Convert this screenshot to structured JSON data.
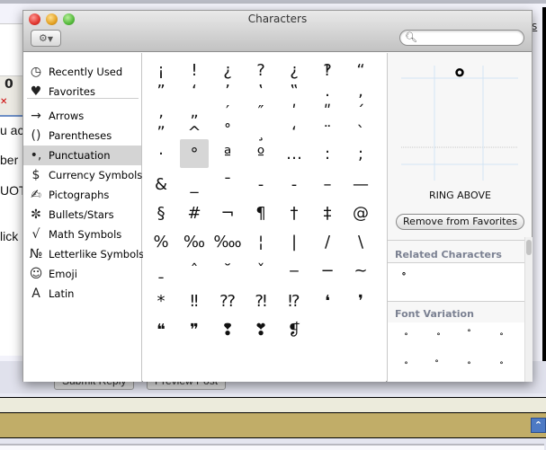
{
  "background_page": {
    "partial_texts": [
      "u ac",
      "ber",
      "UOT",
      "lick"
    ],
    "right_link_fragment": "s",
    "buttons": [
      "Submit Reply",
      "Preview Post"
    ],
    "icons": [
      "paperclip-icon",
      "strikethrough-icon",
      "scroll-to-top-icon"
    ]
  },
  "window": {
    "title": "Characters",
    "action_button_icon": "gear-icon",
    "search": {
      "placeholder": "",
      "value": ""
    }
  },
  "sidebar": {
    "items": [
      {
        "icon": "clock-icon",
        "glyph": "◷",
        "label": "Recently Used"
      },
      {
        "icon": "heart-icon",
        "glyph": "♥",
        "label": "Favorites"
      },
      {
        "icon": "arrow-icon",
        "glyph": "→",
        "label": "Arrows"
      },
      {
        "icon": "parentheses-icon",
        "glyph": "()",
        "label": "Parentheses"
      },
      {
        "icon": "punctuation-icon",
        "glyph": "•,",
        "label": "Punctuation",
        "selected": true
      },
      {
        "icon": "dollar-icon",
        "glyph": "$",
        "label": "Currency Symbols"
      },
      {
        "icon": "pencil-icon",
        "glyph": "✍",
        "label": "Pictographs"
      },
      {
        "icon": "asterisk-icon",
        "glyph": "✼",
        "label": "Bullets/Stars"
      },
      {
        "icon": "square-root-icon",
        "glyph": "√",
        "label": "Math Symbols"
      },
      {
        "icon": "numero-icon",
        "glyph": "№",
        "label": "Letterlike Symbols"
      },
      {
        "icon": "smiley-icon",
        "glyph": "☺",
        "label": "Emoji"
      },
      {
        "icon": "latin-a-icon",
        "glyph": "A",
        "label": "Latin"
      }
    ]
  },
  "grid": {
    "rows": [
      [
        "¡",
        "!",
        "¿",
        "?",
        "¿",
        "‽",
        "“"
      ],
      [
        "”",
        "‘",
        "’",
        "‛",
        "‟",
        ".",
        ","
      ],
      [
        "‚",
        "„",
        "′",
        "″",
        "ʹ",
        "ʺ",
        "ˊ"
      ],
      [
        "ˮ",
        "^",
        "˚",
        "¸",
        "ʻ",
        "¨",
        "ˋ"
      ],
      [
        "·",
        "°",
        "ª",
        "º",
        "…",
        ":",
        ";"
      ],
      [
        "&",
        "_",
        "¯",
        "‐",
        "-",
        "–",
        "—"
      ],
      [
        "§",
        "#",
        "¬",
        "¶",
        "†",
        "‡",
        "@"
      ],
      [
        "%",
        "‰",
        "‱",
        "¦",
        "|",
        "/",
        "\\"
      ],
      [
        "ˍ",
        "ˆ",
        "˘",
        "ˇ",
        "‒",
        "−",
        "~"
      ],
      [
        "*",
        "‼",
        "⁇",
        "⁈",
        "⁉",
        "❛",
        "❜"
      ],
      [
        "❝",
        "❞",
        "❢",
        "❣",
        "❡",
        "",
        ""
      ]
    ],
    "selected": {
      "row": 4,
      "col": 1
    }
  },
  "info": {
    "glyph": "˚",
    "name": "RING ABOVE",
    "favorite_button": "Remove from Favorites",
    "related_title": "Related Characters",
    "related": [
      "˚"
    ],
    "font_variation_title": "Font Variation",
    "font_variations": [
      "˚",
      "˚",
      "˚",
      "˚",
      "˚",
      "˚",
      "˚",
      "˚"
    ]
  }
}
